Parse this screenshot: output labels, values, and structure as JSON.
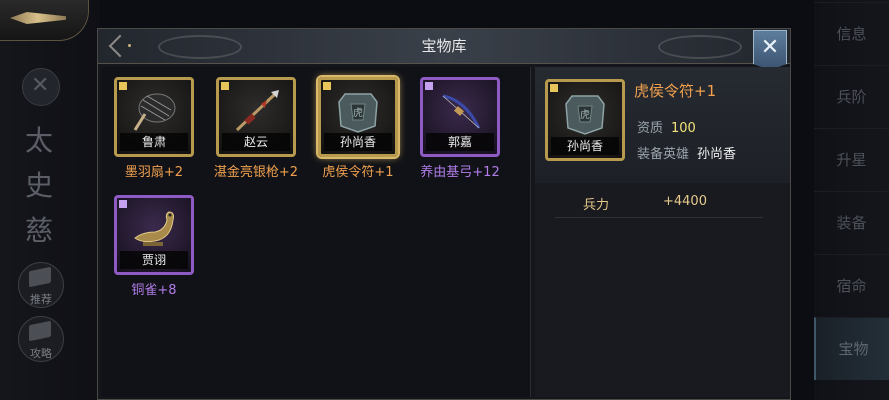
{
  "left_sidebar": {
    "hero_name": "太史慈",
    "buttons": [
      {
        "label": "推荐",
        "icon": "book-icon"
      },
      {
        "label": "攻略",
        "icon": "guide-book-icon"
      }
    ]
  },
  "right_nav": {
    "items": [
      {
        "label": "信息",
        "active": false
      },
      {
        "label": "兵阶",
        "active": false
      },
      {
        "label": "升星",
        "active": false
      },
      {
        "label": "装备",
        "active": false
      },
      {
        "label": "宿命",
        "active": false
      },
      {
        "label": "宝物",
        "active": true
      }
    ]
  },
  "panel": {
    "title": "宝物库",
    "close_icon": "close-x-icon"
  },
  "treasures": [
    {
      "hero": "鲁肃",
      "item": "墨羽扇+2",
      "quality": "gold",
      "icon": "feather-fan-icon",
      "selected": false
    },
    {
      "hero": "赵云",
      "item": "湛金亮银枪+2",
      "quality": "gold",
      "icon": "spear-icon",
      "selected": false
    },
    {
      "hero": "孙尚香",
      "item": "虎侯令符+1",
      "quality": "gold",
      "icon": "tiger-tally-icon",
      "selected": true
    },
    {
      "hero": "郭嘉",
      "item": "养由基弓+12",
      "quality": "purple",
      "icon": "bow-icon",
      "selected": false
    },
    {
      "hero": "贾诩",
      "item": "铜雀+8",
      "quality": "purple",
      "icon": "bronze-bird-icon",
      "selected": false
    }
  ],
  "detail": {
    "name": "虎侯令符+1",
    "hero": "孙尚香",
    "icon": "tiger-tally-icon",
    "quality_label": "资质",
    "quality_value": "100",
    "equip_label": "装备英雄",
    "equip_value": "孙尚香",
    "stats": [
      {
        "label": "兵力",
        "value": "+4400"
      }
    ]
  },
  "colors": {
    "gold_frame": "#b89a4e",
    "purple_frame": "#8e5ac4",
    "orange_text": "#f0a04e",
    "violet_text": "#b07ce8",
    "quality_value": "#f3e37a"
  }
}
